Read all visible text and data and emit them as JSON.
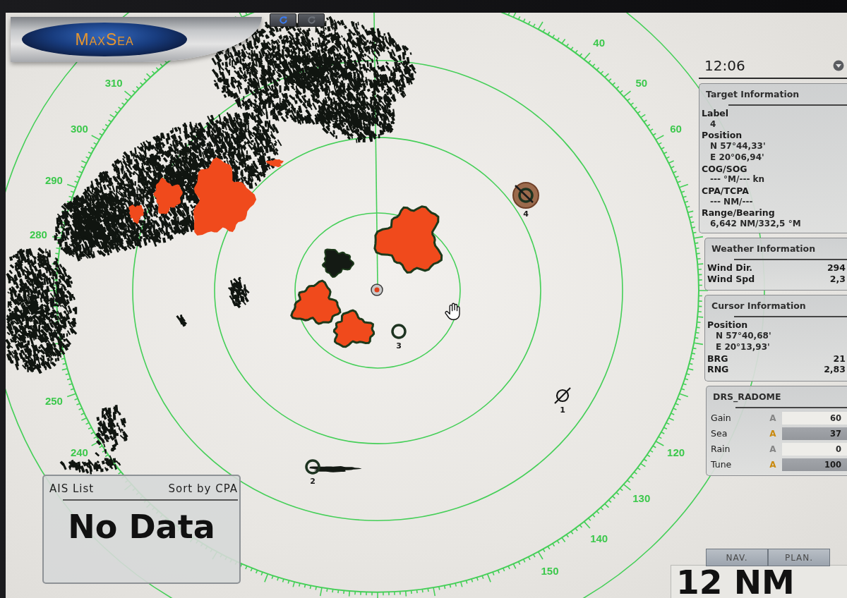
{
  "toolbar": {
    "logo": "MaxSea",
    "buttons": [
      {
        "on": true
      },
      {
        "on": false
      }
    ]
  },
  "radar": {
    "bearing_labels": [
      "40",
      "50",
      "310",
      "60",
      "300",
      "290",
      "280",
      "250",
      "240",
      "120",
      "130",
      "140",
      "150"
    ],
    "targets": [
      {
        "label": "4",
        "kind": "tracked",
        "selected": true
      },
      {
        "label": "3",
        "kind": "tracked",
        "selected": false
      },
      {
        "label": "2",
        "kind": "tracked",
        "selected": false
      },
      {
        "label": "1",
        "kind": "lost",
        "selected": false
      }
    ]
  },
  "side_panel": {
    "time": "12:06",
    "target_info": {
      "title": "Target Information",
      "fields": [
        {
          "label": "Label",
          "values": [
            "4"
          ]
        },
        {
          "label": "Position",
          "values": [
            "N 57°44,33'",
            "E 20°06,94'"
          ]
        },
        {
          "label": "COG/SOG",
          "values": [
            "--- °M/--- kn"
          ]
        },
        {
          "label": "CPA/TCPA",
          "values": [
            "--- NM/---"
          ]
        },
        {
          "label": "Range/Bearing",
          "values": [
            "6,642 NM/332,5 °M"
          ]
        }
      ]
    },
    "weather_info": {
      "title": "Weather Information",
      "rows": [
        {
          "label": "Wind Dir.",
          "value": "294"
        },
        {
          "label": "Wind Spd",
          "value": "2,3"
        }
      ]
    },
    "cursor_info": {
      "title": "Cursor Information",
      "fields": [
        {
          "label": "Position",
          "values": [
            "N 57°40,68'",
            "E 20°13,93'"
          ]
        }
      ],
      "rows": [
        {
          "label": "BRG",
          "value": "21"
        },
        {
          "label": "RNG",
          "value": "2,83"
        }
      ]
    },
    "radar_controls": {
      "title": "DRS_RADOME",
      "controls": [
        {
          "name": "Gain",
          "auto_label": "A",
          "auto": false,
          "value": "60"
        },
        {
          "name": "Sea",
          "auto_label": "A",
          "auto": true,
          "value": "37"
        },
        {
          "name": "Rain",
          "auto_label": "A",
          "auto": false,
          "value": "0"
        },
        {
          "name": "Tune",
          "auto_label": "A",
          "auto": true,
          "value": "100"
        }
      ]
    }
  },
  "ais_list": {
    "title": "AIS List",
    "sort": "Sort by CPA",
    "message": "No Data"
  },
  "mode_tabs": [
    {
      "label": "NAV.",
      "selected": false
    },
    {
      "label": "PLAN.",
      "selected": false
    }
  ],
  "range_display": "12 NM"
}
